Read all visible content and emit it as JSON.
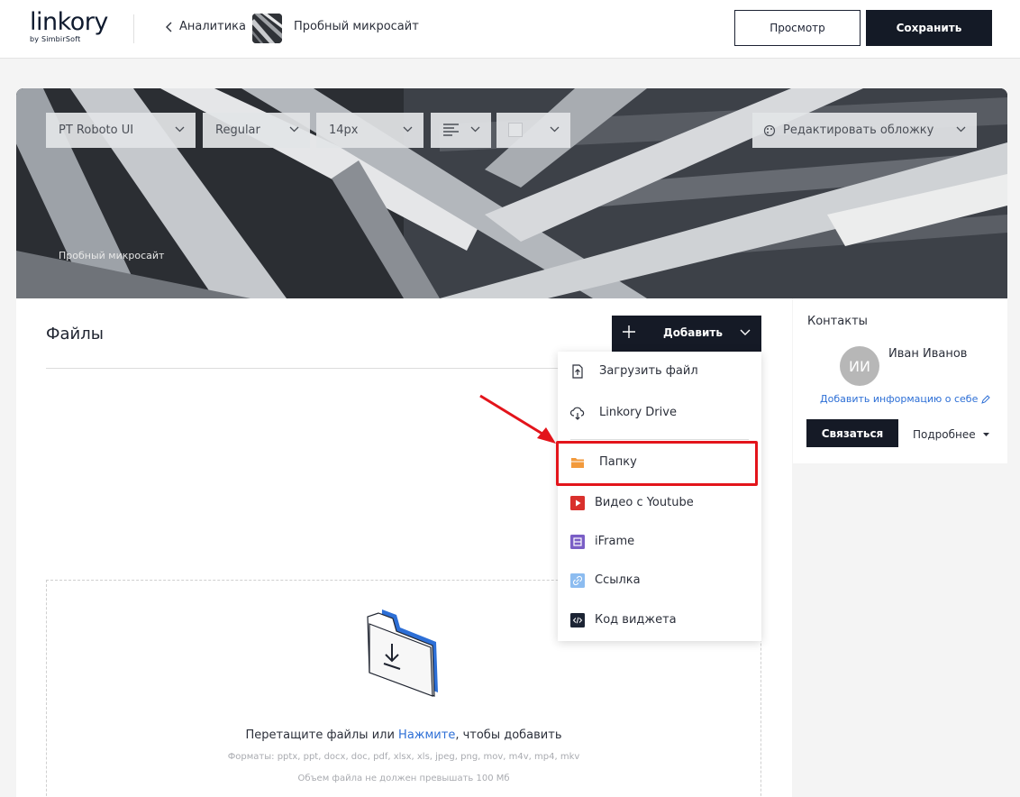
{
  "header": {
    "logo": "linkory",
    "logo_sub": "by SimbirSoft",
    "back_label": "Аналитика",
    "site_name": "Пробный микросайт",
    "preview_label": "Просмотр",
    "save_label": "Сохранить"
  },
  "cover": {
    "font_family_value": "PT Roboto UI",
    "font_weight_value": "Regular",
    "font_size_value": "14px",
    "edit_cover_label": "Редактировать обложку",
    "site_title": "Пробный микросайт"
  },
  "files": {
    "title": "Файлы",
    "add_label": "Добавить",
    "drop_text_before": "Перетащите файлы или ",
    "drop_link": "Нажмите",
    "drop_text_after": ", чтобы добавить",
    "formats": "Форматы: pptx, ppt, docx, doc, pdf, xlsx, xls, jpeg, png, mov, m4v, mp4, mkv",
    "size_limit": "Объем файла не должен превышать 100 Мб"
  },
  "menu": {
    "items": [
      {
        "label": "Загрузить файл",
        "icon": "upload-file-icon"
      },
      {
        "label": "Linkory Drive",
        "icon": "cloud-download-icon"
      },
      {
        "label": "Папку",
        "icon": "folder-icon"
      },
      {
        "label": "Видео с Youtube",
        "icon": "youtube-icon"
      },
      {
        "label": "iFrame",
        "icon": "iframe-icon"
      },
      {
        "label": "Ссылка",
        "icon": "link-icon"
      },
      {
        "label": "Код виджета",
        "icon": "code-icon"
      }
    ]
  },
  "contacts": {
    "title": "Контакты",
    "initials": "ИИ",
    "name": "Иван Иванов",
    "add_info": "Добавить информацию о себе",
    "contact_button": "Связаться",
    "more_label": "Подробнее"
  },
  "colors": {
    "accent_blue": "#2d6fd6",
    "dark": "#151a26",
    "highlight_red": "#e3141b"
  }
}
